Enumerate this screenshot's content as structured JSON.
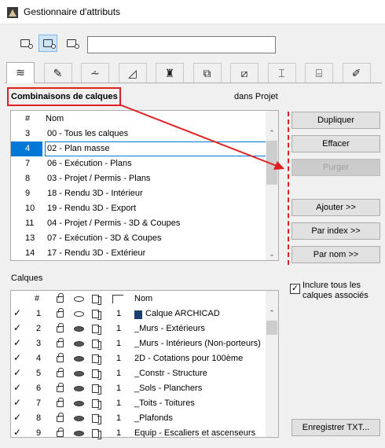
{
  "window": {
    "title": "Gestionnaire d'attributs"
  },
  "toolbar": {
    "search_value": ""
  },
  "tabs": [
    {
      "name": "tab-layers",
      "glyph": "≋"
    },
    {
      "name": "tab-pens",
      "glyph": "✎"
    },
    {
      "name": "tab-linetypes",
      "glyph": "⩪"
    },
    {
      "name": "tab-fills",
      "glyph": "◿"
    },
    {
      "name": "tab-materials",
      "glyph": "♜"
    },
    {
      "name": "tab-composites",
      "glyph": "⧉"
    },
    {
      "name": "tab-profiles",
      "glyph": "⧄"
    },
    {
      "name": "tab-structure",
      "glyph": "⌶"
    },
    {
      "name": "tab-zones",
      "glyph": "⌸"
    },
    {
      "name": "tab-markup",
      "glyph": "✐"
    }
  ],
  "combos": {
    "title": "Combinaisons de calques",
    "scope": "dans Projet",
    "col_num": "#",
    "col_name": "Nom",
    "rows": [
      {
        "num": "3",
        "name": "00 - Tous les calques"
      },
      {
        "num": "4",
        "name": "02 - Plan masse"
      },
      {
        "num": "7",
        "name": "06 - Exécution - Plans"
      },
      {
        "num": "8",
        "name": "03 - Projet / Permis - Plans"
      },
      {
        "num": "9",
        "name": "18 - Rendu 3D - Intérieur"
      },
      {
        "num": "10",
        "name": "19 - Rendu 3D - Export"
      },
      {
        "num": "11",
        "name": "04 - Projet / Permis - 3D & Coupes"
      },
      {
        "num": "13",
        "name": "07 - Exécution - 3D & Coupes"
      },
      {
        "num": "14",
        "name": "17 - Rendu 3D - Extérieur"
      }
    ]
  },
  "buttons": {
    "duplicate": "Dupliquer",
    "delete": "Effacer",
    "purge": "Purger",
    "add": "Ajouter >>",
    "by_index": "Par index >>",
    "by_name": "Par nom >>",
    "save_txt": "Enregistrer TXT..."
  },
  "layers": {
    "title": "Calques",
    "col_num": "#",
    "col_name": "Nom",
    "include_all_label": "Inclure tous les calques associés",
    "include_all_checked": true,
    "rows": [
      {
        "num": "1",
        "pen": "1",
        "name": "Calque ARCHICAD",
        "locked": false,
        "visible": true
      },
      {
        "num": "2",
        "pen": "1",
        "name": "_Murs - Extérieurs",
        "locked": true,
        "visible": false
      },
      {
        "num": "3",
        "pen": "1",
        "name": "_Murs - Intérieurs (Non-porteurs)",
        "locked": true,
        "visible": false
      },
      {
        "num": "4",
        "pen": "1",
        "name": "2D - Cotations pour 100ème",
        "locked": true,
        "visible": false
      },
      {
        "num": "5",
        "pen": "1",
        "name": "_Constr - Structure",
        "locked": true,
        "visible": false
      },
      {
        "num": "6",
        "pen": "1",
        "name": "_Sols - Planchers",
        "locked": true,
        "visible": false
      },
      {
        "num": "7",
        "pen": "1",
        "name": "_Toits - Toitures",
        "locked": true,
        "visible": false
      },
      {
        "num": "8",
        "pen": "1",
        "name": "_Plafonds",
        "locked": true,
        "visible": false
      },
      {
        "num": "9",
        "pen": "1",
        "name": "Equip - Escaliers et ascenseurs",
        "locked": true,
        "visible": false
      }
    ]
  },
  "colors": {
    "selection": "#0078d7",
    "annotation": "#e02020"
  }
}
